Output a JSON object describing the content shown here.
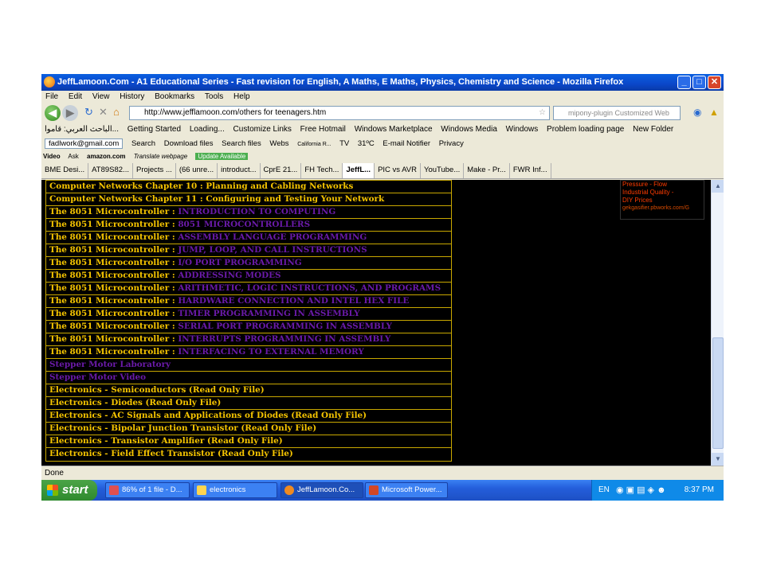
{
  "window": {
    "title": "JeffLamoon.Com - A1 Educational Series - Fast revision for English, A Maths, E Maths, Physics, Chemistry and Science - Mozilla Firefox"
  },
  "menu": [
    "File",
    "Edit",
    "View",
    "History",
    "Bookmarks",
    "Tools",
    "Help"
  ],
  "nav": {
    "url": "http://www.jefflamoon.com/others for teenagers.htm",
    "search_placeholder": "mipony-plugin Customized Web"
  },
  "bookmarks": [
    "الباحث العربي: قاموا...",
    "Getting Started",
    "Loading...",
    "Customize Links",
    "Free Hotmail",
    "Windows Marketplace",
    "Windows Media",
    "Windows",
    "Problem loading page",
    "New Folder"
  ],
  "mipony_toolbar": {
    "email": "fadlwork@gmail.com",
    "items": [
      "Search",
      "Download files",
      "Search files",
      "Webs",
      "California R...",
      "TV",
      "31ºC",
      "E-mail Notifier",
      "Privacy"
    ]
  },
  "ask_toolbar": {
    "items": [
      "Video",
      "Ask",
      "amazon.com",
      "Translate webpage"
    ],
    "update": "Update Available"
  },
  "tabs": [
    "BME Desi...",
    "AT89S82...",
    "Projects ...",
    "(66 unre...",
    "introduct...",
    "CprE 21...",
    "FH Tech...",
    "JeffL...",
    "PIC vs AVR",
    "YouTube...",
    "Make - Pr...",
    "FWR Inf..."
  ],
  "content": {
    "rows": [
      {
        "a": "Computer Networks Chapter 10 : Planning and Cabling Networks",
        "b": ""
      },
      {
        "a": "Computer Networks Chapter 11 : Configuring and Testing Your Network",
        "b": ""
      },
      {
        "a": "The 8051 Microcontroller : ",
        "b": "INTRODUCTION TO COMPUTING"
      },
      {
        "a": "The 8051 Microcontroller : ",
        "b": "8051 MICROCONTROLLERS"
      },
      {
        "a": "The 8051 Microcontroller : ",
        "b": "ASSEMBLY LANGUAGE PROGRAMMING"
      },
      {
        "a": "The 8051 Microcontroller : ",
        "b": "JUMP, LOOP, AND CALL INSTRUCTIONS"
      },
      {
        "a": "The 8051 Microcontroller : ",
        "b": "I/O PORT PROGRAMMING"
      },
      {
        "a": "The 8051 Microcontroller : ",
        "b": "ADDRESSING MODES"
      },
      {
        "a": "The 8051 Microcontroller : ",
        "b": "ARITHMETIC, LOGIC INSTRUCTIONS, AND PROGRAMS"
      },
      {
        "a": "The 8051 Microcontroller : ",
        "b": "HARDWARE CONNECTION AND INTEL HEX FILE"
      },
      {
        "a": "The 8051 Microcontroller : ",
        "b": "TIMER PROGRAMMING IN ASSEMBLY"
      },
      {
        "a": "The 8051 Microcontroller : ",
        "b": "SERIAL PORT PROGRAMMING IN ASSEMBLY"
      },
      {
        "a": "The 8051 Microcontroller : ",
        "b": "INTERRUPTS PROGRAMMING IN ASSEMBLY"
      },
      {
        "a": "The 8051 Microcontroller : ",
        "b": "INTERFACING TO EXTERNAL MEMORY"
      },
      {
        "a": "",
        "b": "Stepper Motor Laboratory"
      },
      {
        "a": "",
        "b": "Stepper Motor Video"
      },
      {
        "a": "Electronics - Semiconductors (Read Only File)",
        "b": ""
      },
      {
        "a": "Electronics - Diodes (Read Only File)",
        "b": ""
      },
      {
        "a": "Electronics - AC Signals and Applications of Diodes (Read Only File)",
        "b": ""
      },
      {
        "a": "Electronics - Bipolar Junction Transistor (Read Only File)",
        "b": ""
      },
      {
        "a": "Electronics - Transistor Amplifier (Read Only File)",
        "b": ""
      },
      {
        "a": "Electronics - Field Effect Transistor (Read Only File)",
        "b": ""
      }
    ],
    "ad": {
      "line1": "Pressure - Flow",
      "line2": "Industrial Quality -",
      "line3": "DIY Prices",
      "url": "gekgasifier.pbworks.com/G"
    }
  },
  "status": "Done",
  "taskbar": {
    "start": "start",
    "tasks": [
      "86% of 1 file - D...",
      "electronics",
      "JeffLamoon.Co...",
      "Microsoft Power..."
    ],
    "lang": "EN",
    "time": "8:37 PM"
  },
  "colors": {
    "link_yellow": "#f5c400",
    "visited_purple": "#6a1aa8",
    "content_bg": "#000000"
  }
}
